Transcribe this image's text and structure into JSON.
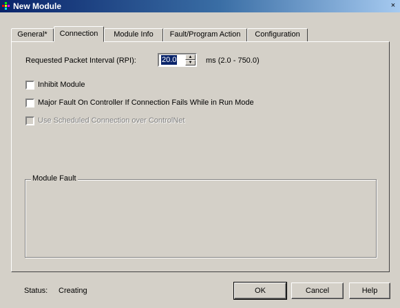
{
  "window": {
    "title": "New Module",
    "close_glyph": "×"
  },
  "tabs": [
    {
      "label": "General*",
      "active": false
    },
    {
      "label": "Connection",
      "active": true
    },
    {
      "label": "Module Info",
      "active": false
    },
    {
      "label": "Fault/Program Action",
      "active": false
    },
    {
      "label": "Configuration",
      "active": false
    }
  ],
  "connection": {
    "rpi_label": "Requested Packet Interval (RPI):",
    "rpi_value": "20.0",
    "rpi_units": "ms (2.0 - 750.0)",
    "checkboxes": [
      {
        "label": "Inhibit Module",
        "checked": false,
        "enabled": true
      },
      {
        "label": "Major Fault On Controller If Connection Fails While in Run Mode",
        "checked": false,
        "enabled": true
      },
      {
        "label": "Use Scheduled Connection over ControlNet",
        "checked": false,
        "enabled": false
      }
    ],
    "module_fault_title": "Module Fault"
  },
  "status": {
    "label": "Status:",
    "value": "Creating"
  },
  "buttons": {
    "ok": "OK",
    "cancel": "Cancel",
    "help": "Help"
  },
  "colors": {
    "titlebar_start": "#0a246a",
    "titlebar_end": "#a6caf0",
    "face": "#d4d0c8",
    "selection": "#0a246a"
  }
}
